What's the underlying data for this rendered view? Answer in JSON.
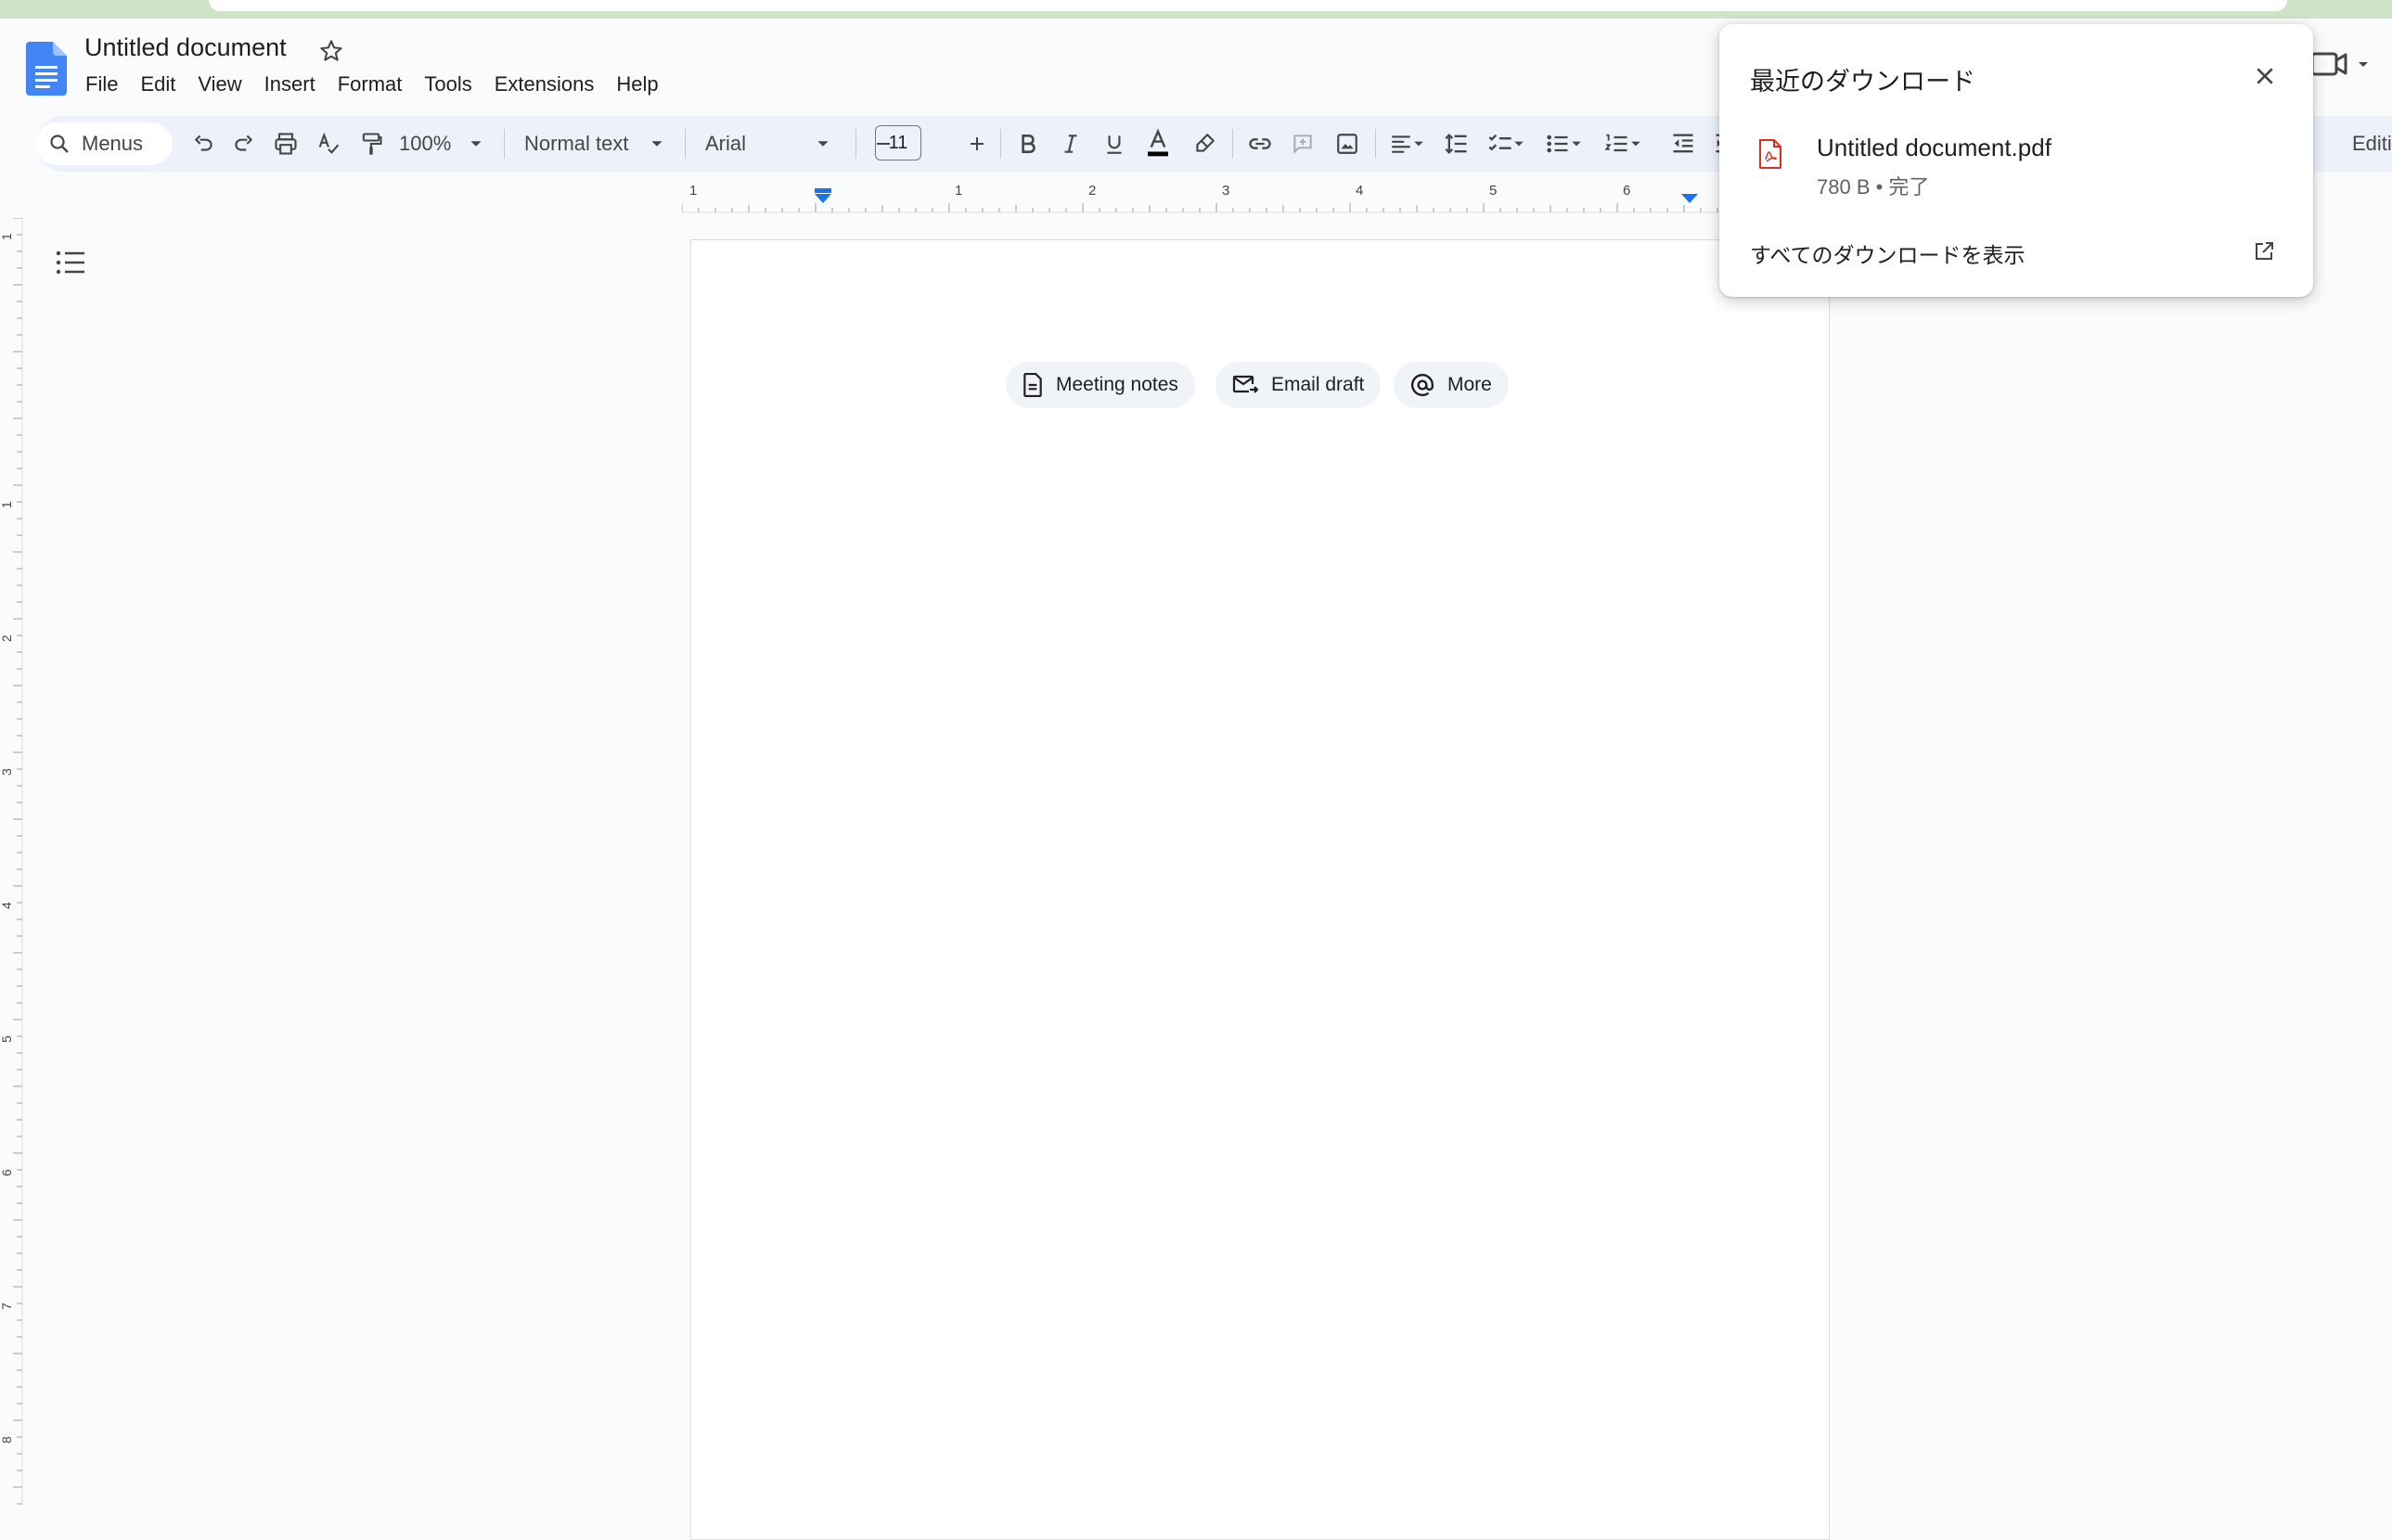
{
  "colors": {
    "docs_blue": "#4285f4",
    "accent_blue": "#1a73e8",
    "pdf_red": "#d93025",
    "background": "#f9fbfd",
    "toolbar_bg": "#edf2fa",
    "chip_bg": "#f0f4f9"
  },
  "header": {
    "logo_icon": "google-docs-icon",
    "title": "Untitled document",
    "star_icon": "star-outline-icon",
    "meet_icon": "video-camera-icon"
  },
  "menubar": {
    "items": [
      "File",
      "Edit",
      "View",
      "Insert",
      "Format",
      "Tools",
      "Extensions",
      "Help"
    ]
  },
  "toolbar": {
    "search_label": "Menus",
    "zoom": "100%",
    "style": "Normal text",
    "font": "Arial",
    "font_size": "11",
    "editing_mode": "Editing"
  },
  "ruler": {
    "top_labels": [
      "1",
      "1",
      "2",
      "3",
      "4",
      "5",
      "6"
    ],
    "left_labels": [
      "1",
      "1",
      "2",
      "3",
      "4",
      "5",
      "6",
      "7",
      "8"
    ]
  },
  "chips": [
    {
      "label": "Meeting notes",
      "icon": "document-icon"
    },
    {
      "label": "Email draft",
      "icon": "email-arrow-icon"
    },
    {
      "label": "More",
      "icon": "at-sign-icon"
    }
  ],
  "downloads": {
    "title": "最近のダウンロード",
    "close_icon": "close-icon",
    "file_name": "Untitled document.pdf",
    "file_icon": "pdf-file-icon",
    "file_status": "780 B • 完了",
    "show_all": "すべてのダウンロードを表示",
    "open_icon": "open-in-new-icon"
  }
}
